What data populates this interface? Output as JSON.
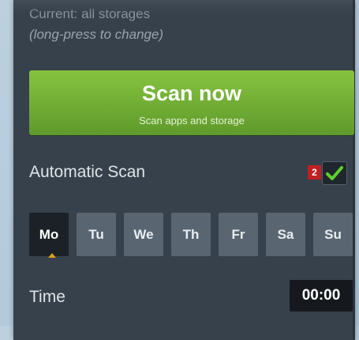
{
  "storage": {
    "current": "Current: all storages",
    "hint": "(long-press to change)"
  },
  "scan_button": {
    "title": "Scan now",
    "subtitle": "Scan apps and storage"
  },
  "automatic_scan": {
    "label": "Automatic Scan",
    "badge": "2",
    "checked": true
  },
  "days": [
    {
      "label": "Mo",
      "selected": true
    },
    {
      "label": "Tu",
      "selected": false
    },
    {
      "label": "We",
      "selected": false
    },
    {
      "label": "Th",
      "selected": false
    },
    {
      "label": "Fr",
      "selected": false
    },
    {
      "label": "Sa",
      "selected": false
    },
    {
      "label": "Su",
      "selected": false
    }
  ],
  "time": {
    "label": "Time",
    "value": "00:00"
  },
  "colors": {
    "panel": "#37414b",
    "accent_green": "#72b035",
    "badge_red": "#c01f24",
    "check_green": "#5fd12b",
    "day_marker": "#d9a21a"
  },
  "icons": {
    "checkbox": "checkmark-icon"
  }
}
